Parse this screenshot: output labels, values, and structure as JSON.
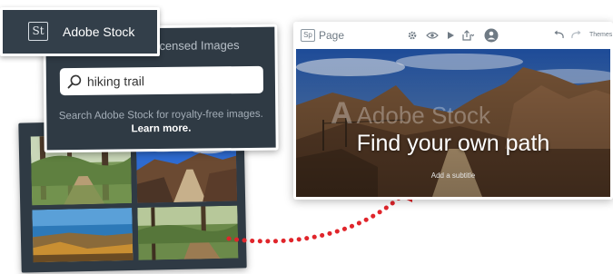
{
  "stock_panel": {
    "header_title": "Adobe Stock",
    "logo_text": "St",
    "subtitle_visible": "icensed Images",
    "search": {
      "value": "hiking trail",
      "icon": "search-icon"
    },
    "hint_text": "Search Adobe Stock for royalty-free images.",
    "learn_more": "Learn more."
  },
  "thumbnails": [
    {
      "label": "forest-trail-photo"
    },
    {
      "label": "rocky-path-photo"
    },
    {
      "label": "coastal-sunset-photo"
    },
    {
      "label": "woodland-path-photo"
    }
  ],
  "editor": {
    "logo_text": "Sp",
    "doc_title": "Page",
    "tools": [
      "gear-icon",
      "eye-icon",
      "play-icon",
      "share-icon",
      "user-icon",
      "undo-icon",
      "redo-icon"
    ],
    "themes_label": "Themes",
    "hero": {
      "title": "Find your own path",
      "subtitle": "Add a subtitle",
      "watermark": "Adobe Stock",
      "watermark_mark": "A"
    }
  },
  "colors": {
    "panel_bg": "#2f3a44",
    "arrow_red": "#e0252b",
    "text_white": "#ffffff"
  }
}
